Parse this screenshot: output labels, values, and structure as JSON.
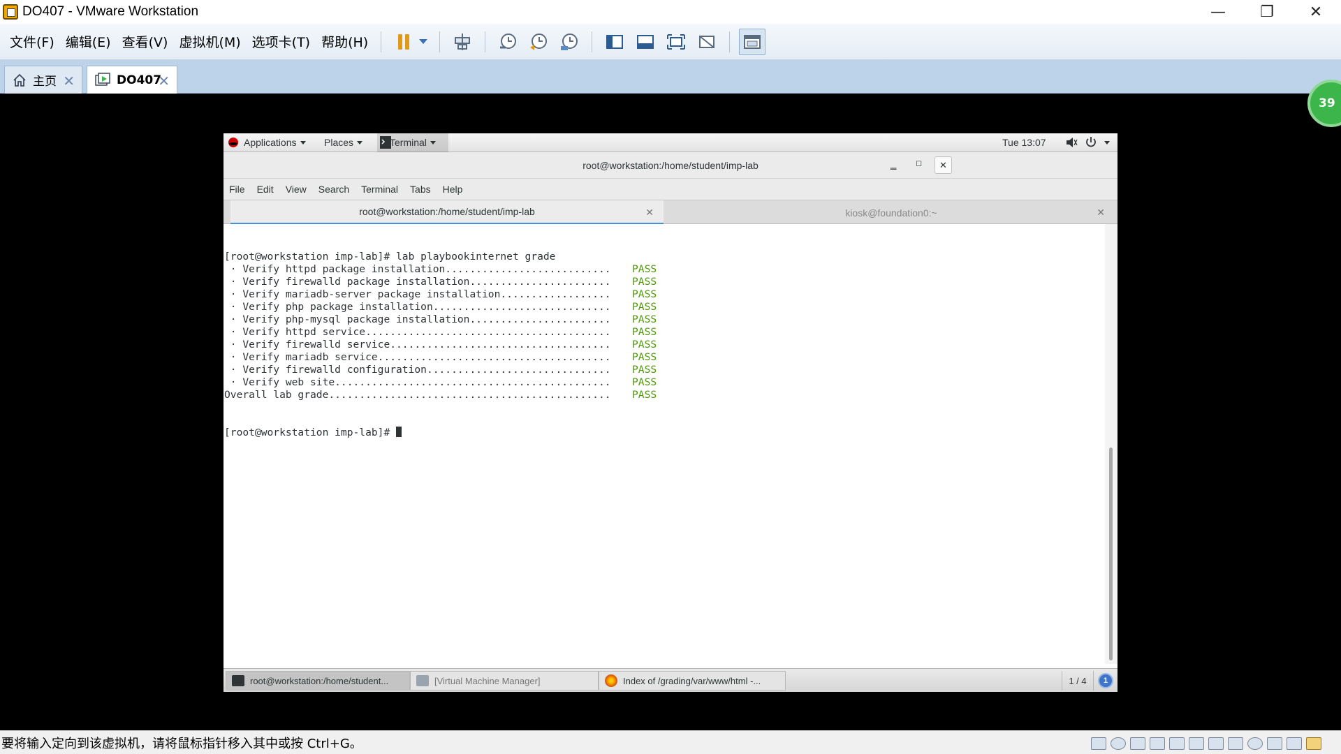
{
  "window": {
    "title": "DO407 - VMware Workstation",
    "minimize": "—",
    "restore": "❐",
    "close": "✕"
  },
  "menu": [
    "文件(F)",
    "编辑(E)",
    "查看(V)",
    "虚拟机(M)",
    "选项卡(T)",
    "帮助(H)"
  ],
  "tabs": [
    {
      "label": "主页",
      "active": false
    },
    {
      "label": "DO407",
      "active": true
    }
  ],
  "badge": "39",
  "guest": {
    "topbar": {
      "applications": "Applications",
      "places": "Places",
      "terminal": "Terminal",
      "clock": "Tue 13:07"
    },
    "terminal": {
      "title": "root@workstation:/home/student/imp-lab",
      "menus": [
        "File",
        "Edit",
        "View",
        "Search",
        "Terminal",
        "Tabs",
        "Help"
      ],
      "tabs": [
        {
          "label": "root@workstation:/home/student/imp-lab",
          "active": true
        },
        {
          "label": "kiosk@foundation0:~",
          "active": false
        }
      ],
      "lines": [
        {
          "text": "[root@workstation imp-lab]# lab playbookinternet grade",
          "status": ""
        },
        {
          "text": " · Verify httpd package installation...........................",
          "status": "PASS"
        },
        {
          "text": " · Verify firewalld package installation.......................",
          "status": "PASS"
        },
        {
          "text": " · Verify mariadb-server package installation..................",
          "status": "PASS"
        },
        {
          "text": " · Verify php package installation.............................",
          "status": "PASS"
        },
        {
          "text": " · Verify php-mysql package installation.......................",
          "status": "PASS"
        },
        {
          "text": " · Verify httpd service........................................",
          "status": "PASS"
        },
        {
          "text": " · Verify firewalld service....................................",
          "status": "PASS"
        },
        {
          "text": " · Verify mariadb service......................................",
          "status": "PASS"
        },
        {
          "text": " · Verify firewalld configuration..............................",
          "status": "PASS"
        },
        {
          "text": " · Verify web site.............................................",
          "status": "PASS"
        },
        {
          "text": "Overall lab grade..............................................",
          "status": "PASS"
        }
      ],
      "prompt": "[root@workstation imp-lab]# "
    },
    "taskbar": {
      "items": [
        {
          "label": "root@workstation:/home/student...",
          "icon": "terminal-icon"
        },
        {
          "label": "[Virtual Machine Manager]",
          "icon": "vmm-icon"
        },
        {
          "label": "Index of /grading/var/www/html -...",
          "icon": "firefox-icon"
        }
      ],
      "workspace": "1 / 4",
      "notification_count": "1"
    }
  },
  "statusbar": {
    "message": "要将输入定向到该虚拟机，请将鼠标指针移入其中或按 Ctrl+G。"
  },
  "colors": {
    "pass": "#4e9a06",
    "tab_bar": "#bcd3ea",
    "pause": "#e09a18"
  }
}
